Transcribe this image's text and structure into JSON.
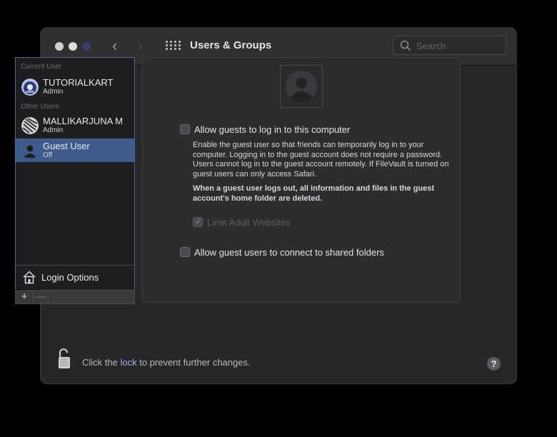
{
  "window": {
    "title": "Users & Groups"
  },
  "search": {
    "placeholder": "Search"
  },
  "sidebar": {
    "current_user_label": "Current User",
    "other_users_label": "Other Users",
    "users": [
      {
        "name": "TUTORIALKART",
        "role": "Admin",
        "selected": false
      },
      {
        "name": "MALLIKARJUNA M",
        "role": "Admin",
        "selected": false
      },
      {
        "name": "Guest User",
        "role": "Off",
        "selected": true
      }
    ],
    "login_options": "Login Options",
    "add_label": "+",
    "remove_label": "—"
  },
  "guest_panel": {
    "allow_login_label": "Allow guests to log in to this computer",
    "description": "Enable the guest user so that friends can temporarily log in to your computer. Logging in to the guest account does not require a password. Users cannot log in to the guest account remotely. If FileVault is turned on guest users can only access Safari.",
    "warning": "When a guest user logs out, all information and files in the guest account's home folder are deleted.",
    "limit_adult_label": "Limit Adult Websites",
    "shared_folders_label": "Allow guest users to connect to shared folders"
  },
  "footer": {
    "lock_text_prefix": "Click the ",
    "lock_link": "lock",
    "lock_text_suffix": " to prevent further changes.",
    "help_label": "?"
  },
  "colors": {
    "selection": "#3f5b8c",
    "background": "#272729",
    "accent_link": "#9bb3e5"
  }
}
